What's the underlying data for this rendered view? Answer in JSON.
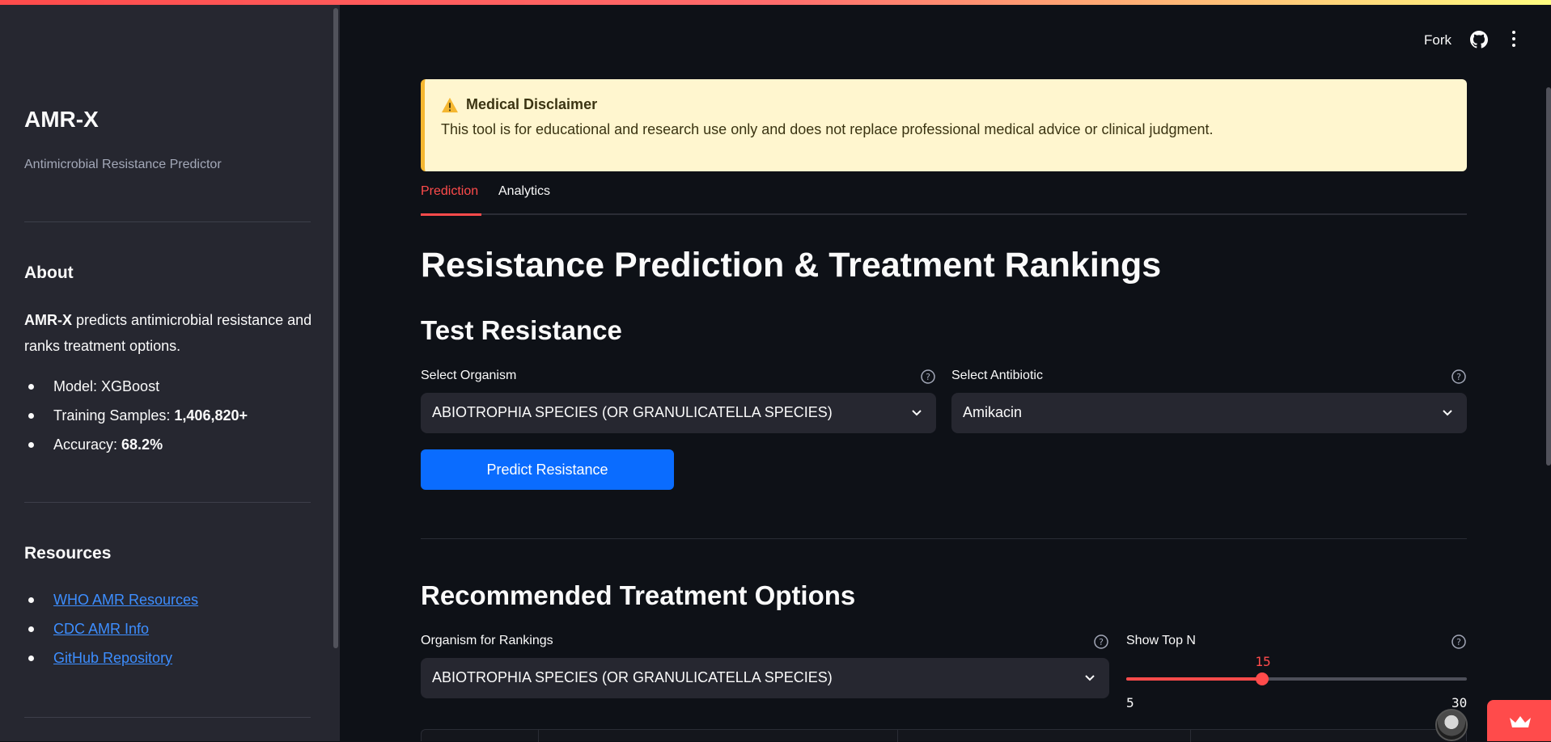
{
  "header": {
    "fork_label": "Fork",
    "github_icon": "github-icon",
    "menu_icon": "more-vertical-icon"
  },
  "sidebar": {
    "title": "AMR-X",
    "subtitle": "Antimicrobial Resistance Predictor",
    "about": {
      "heading": "About",
      "brand": "AMR-X",
      "description": " predicts antimicrobial resistance and ranks treatment options.",
      "model_label": "Model: ",
      "model_value": "XGBoost",
      "samples_label": "Training Samples: ",
      "samples_value": "1,406,820+",
      "accuracy_label": "Accuracy: ",
      "accuracy_value": "68.2%"
    },
    "resources": {
      "heading": "Resources",
      "links": [
        "WHO AMR Resources",
        "CDC AMR Info",
        "GitHub Repository"
      ]
    }
  },
  "disclaimer": {
    "icon": "warning-icon",
    "title": "Medical Disclaimer",
    "text": "This tool is for educational and research use only and does not replace professional medical advice or clinical judgment."
  },
  "tabs": [
    {
      "label": "Prediction",
      "active": true
    },
    {
      "label": "Analytics",
      "active": false
    }
  ],
  "page_title": "Resistance Prediction & Treatment Rankings",
  "test_section": {
    "heading": "Test Resistance",
    "organism_label": "Select Organism",
    "organism_value": "ABIOTROPHIA SPECIES (OR GRANULICATELLA SPECIES)",
    "antibiotic_label": "Select Antibiotic",
    "antibiotic_value": "Amikacin",
    "predict_button": "Predict Resistance"
  },
  "treatment_section": {
    "heading": "Recommended Treatment Options",
    "organism_label": "Organism for Rankings",
    "organism_value": "ABIOTROPHIA SPECIES (OR GRANULICATELLA SPECIES)",
    "topn_label": "Show Top N",
    "topn_value": 15,
    "topn_value_text": "15",
    "topn_min": "5",
    "topn_max": "30"
  },
  "colors": {
    "accent": "#ff4b4b",
    "primary_button": "#0a6cff",
    "link": "#3d8eff",
    "disclaimer_bg": "#fff6cf"
  }
}
